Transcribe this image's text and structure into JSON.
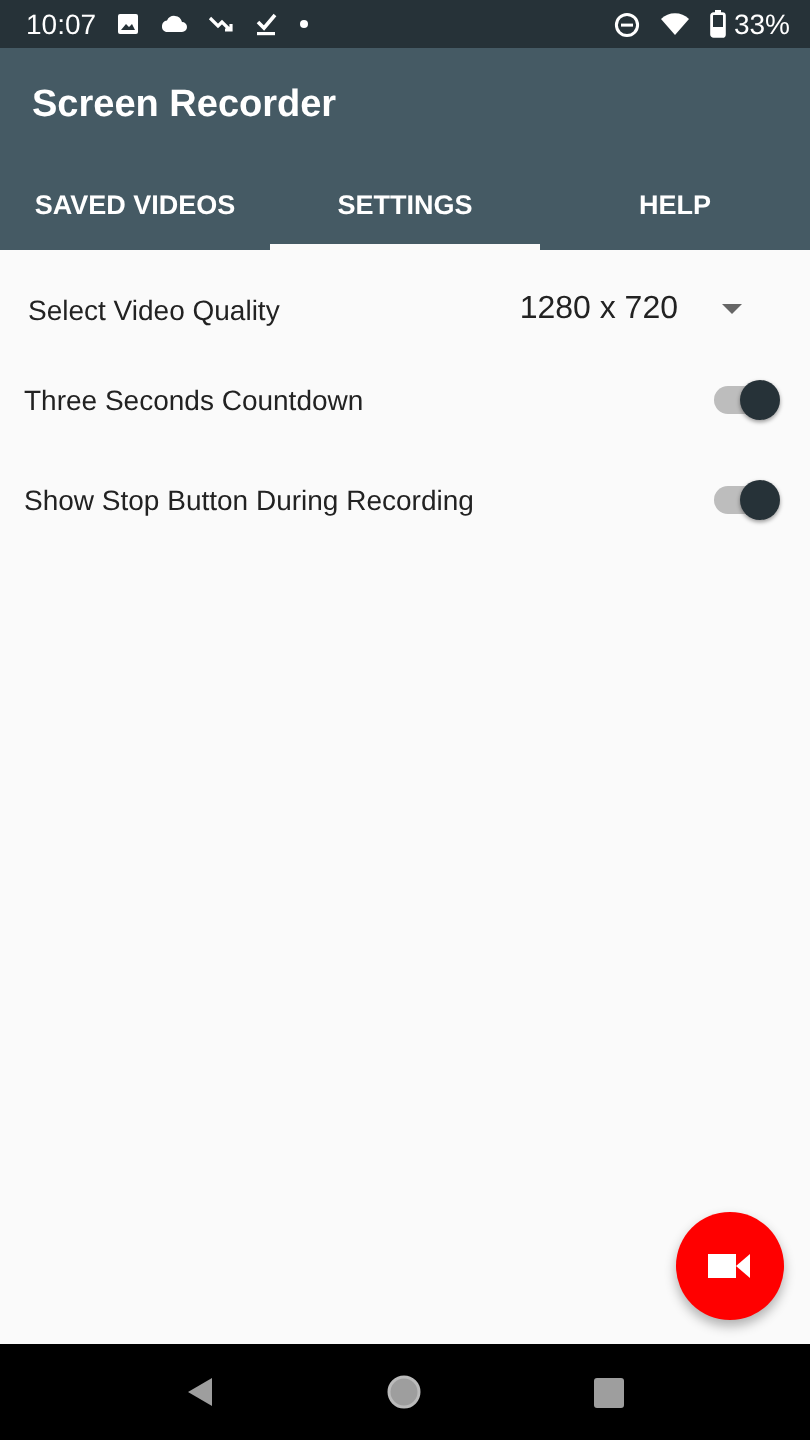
{
  "status_bar": {
    "time": "10:07",
    "battery": "33%"
  },
  "app_bar": {
    "title": "Screen Recorder"
  },
  "tabs": [
    {
      "label": "SAVED VIDEOS",
      "selected": false
    },
    {
      "label": "SETTINGS",
      "selected": true
    },
    {
      "label": "HELP",
      "selected": false
    }
  ],
  "settings": [
    {
      "kind": "dropdown",
      "label": "Select Video Quality",
      "value": "1280 x 720"
    },
    {
      "kind": "switch",
      "label": "Three Seconds Countdown",
      "on": true
    },
    {
      "kind": "switch",
      "label": "Show Stop Button During Recording",
      "on": true
    }
  ]
}
